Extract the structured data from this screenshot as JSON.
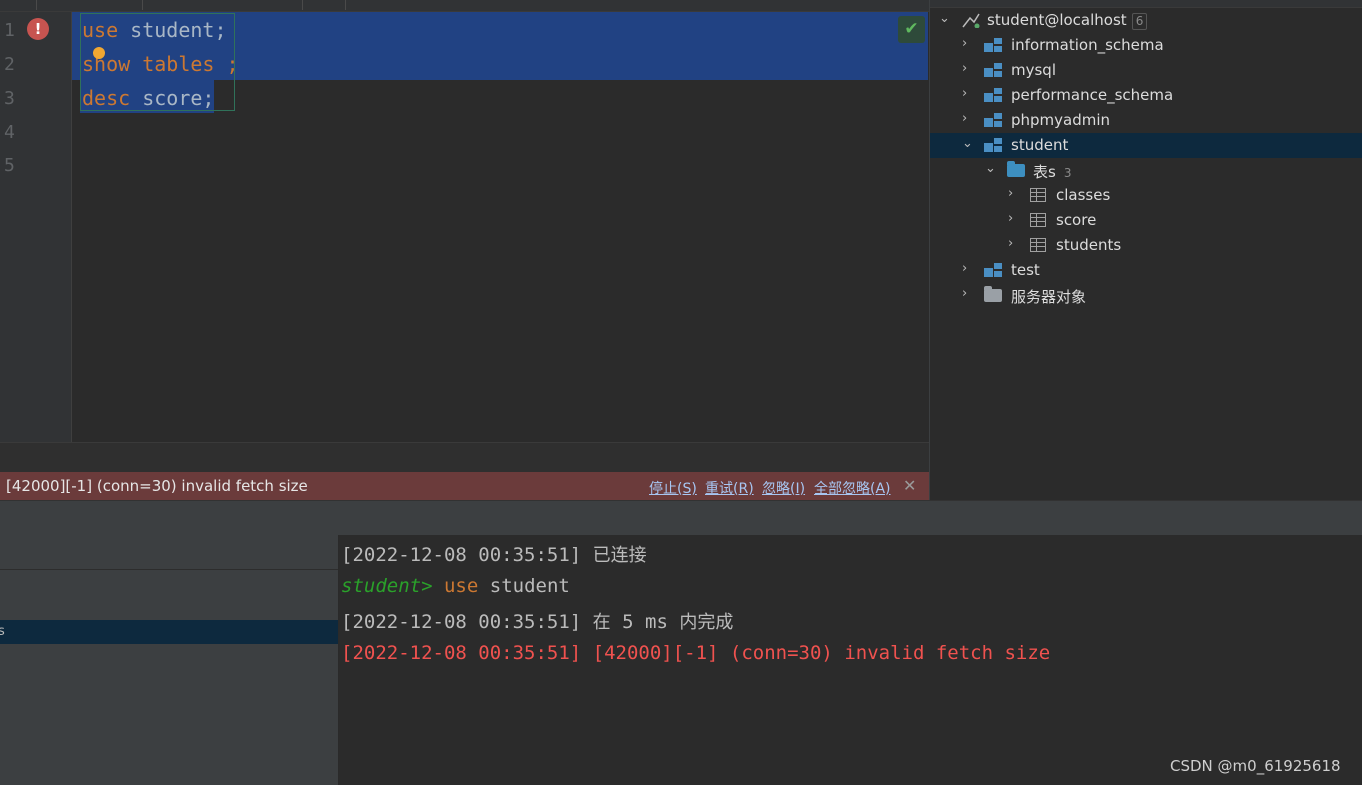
{
  "editor": {
    "line_numbers": [
      "1",
      "2",
      "3",
      "4",
      "5"
    ],
    "lines": [
      {
        "kw": "use",
        "rest": " student;"
      },
      {
        "kw": "show tables",
        "rest": " ;"
      },
      {
        "kw": "desc",
        "rest": " score;"
      }
    ],
    "error_icon": "!",
    "run_check_icon": "✔"
  },
  "error_bar": {
    "message": "[42000][-1] (conn=30) invalid fetch size",
    "actions": [
      "停止(S)",
      "重试(R)",
      "忽略(I)",
      "全部忽略(A)"
    ],
    "close": "✕"
  },
  "explorer": {
    "root": {
      "label": "student@localhost",
      "count": "6"
    },
    "schemas": [
      "information_schema",
      "mysql",
      "performance_schema",
      "phpmyadmin",
      "student",
      "test"
    ],
    "tables_folder": {
      "label": "表s",
      "count": "3"
    },
    "tables": [
      "classes",
      "score",
      "students"
    ],
    "server_objects": "服务器对象"
  },
  "bottom_left": {
    "selected_item": "s"
  },
  "console": {
    "line1": {
      "time": "[2022-12-08 00:35:51]",
      "text": "已连接"
    },
    "line2": {
      "prompt": "student>",
      "kw": "use",
      "arg": "student"
    },
    "line3": {
      "time": "[2022-12-08 00:35:51]",
      "pre": "在",
      "num": "5 ms",
      "post": "内完成"
    },
    "line4": "[2022-12-08 00:35:51] [42000][-1] (conn=30) invalid fetch size"
  },
  "watermark": "CSDN @m0_61925618",
  "colors": {
    "selection": "#214283",
    "error_bar": "#6b3b3b",
    "keyword": "#cc7832",
    "error_text": "#f0524f",
    "prompt": "#2aa12a"
  }
}
